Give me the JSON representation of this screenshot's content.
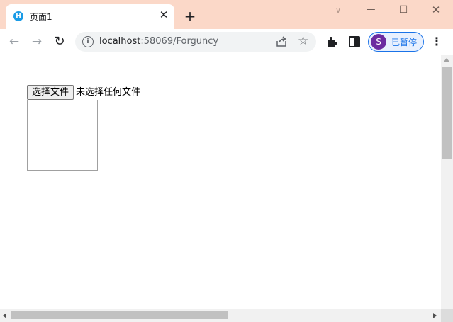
{
  "browser": {
    "tab": {
      "title": "页面1",
      "favicon": "H",
      "close_label": "✕"
    },
    "new_tab_label": "+",
    "window_controls": {
      "dropdown": "∨",
      "minimize": "—",
      "maximize": "☐",
      "close": "✕"
    },
    "nav": {
      "back": "←",
      "forward": "→",
      "reload": "↻"
    },
    "address": {
      "host": "localhost",
      "path": ":58069/Forguncy",
      "info_icon": "i"
    },
    "star": "☆",
    "profile": {
      "initial": "S",
      "status": "已暂停"
    },
    "menu": "⋮"
  },
  "page": {
    "file_input": {
      "button_label": "选择文件",
      "status_text": "未选择任何文件"
    }
  }
}
